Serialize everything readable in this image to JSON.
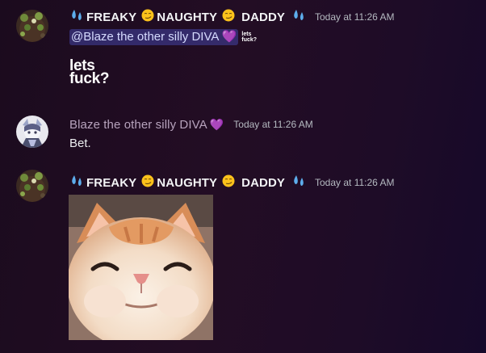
{
  "messages": [
    {
      "author": {
        "name_parts": [
          "FREAKY",
          "NAUGHTY",
          "DADDY"
        ],
        "emojis": [
          "sweat-droplets-emoji",
          "smirk-emoji",
          "smirk-emoji",
          "sweat-droplets-emoji"
        ]
      },
      "timestamp": "Today at 11:26 AM",
      "mention": "@Blaze the other silly DIVA",
      "mention_emoji": "purple-heart-emoji",
      "small_sticker_text": "lets fuck?",
      "sticker_text_line1": "lets",
      "sticker_text_line2": "fuck?"
    },
    {
      "author": {
        "name": "Blaze the other silly DIVA",
        "emoji": "purple-heart-emoji"
      },
      "timestamp": "Today at 11:26 AM",
      "text": "Bet."
    },
    {
      "author": {
        "name_parts": [
          "FREAKY",
          "NAUGHTY",
          "DADDY"
        ],
        "emojis": [
          "sweat-droplets-emoji",
          "smirk-emoji",
          "smirk-emoji",
          "sweat-droplets-emoji"
        ]
      },
      "timestamp": "Today at 11:26 AM",
      "image": "smiling-cat-image"
    }
  ],
  "colors": {
    "background": "#1e0c24",
    "username": "#f2f3f5",
    "username_muted": "#b7a3bd",
    "timestamp": "#b5bac1",
    "mention_bg": "#5865f2"
  }
}
